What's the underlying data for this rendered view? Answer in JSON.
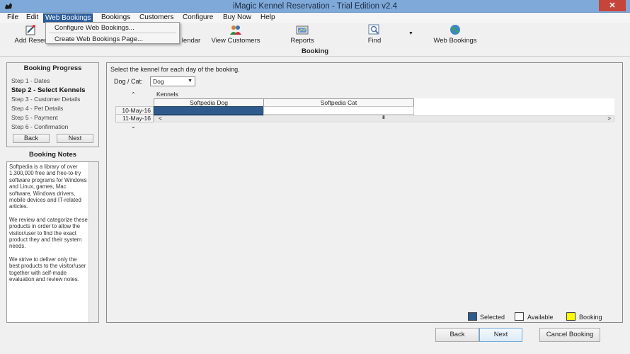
{
  "window": {
    "title": "iMagic Kennel Reservation - Trial Edition v2.4",
    "close_label": "✕"
  },
  "menu": [
    {
      "label": "File"
    },
    {
      "label": "Edit"
    },
    {
      "label": "Web Bookings"
    },
    {
      "label": "Bookings"
    },
    {
      "label": "Customers"
    },
    {
      "label": "Configure"
    },
    {
      "label": "Buy Now"
    },
    {
      "label": "Help"
    }
  ],
  "dropdown": {
    "items": [
      "Configure Web Bookings...",
      "Create Web Bookings Page..."
    ]
  },
  "toolbar": {
    "add_reservation": "Add Reser",
    "calendar": "lendar",
    "view_customers": "View Customers",
    "reports": "Reports",
    "find": "Find",
    "web_bookings": "Web Bookings",
    "more_arrow": "▼"
  },
  "header": {
    "title": "Booking"
  },
  "progress": {
    "title": "Booking Progress",
    "steps": [
      "Step 1 - Dates",
      "Step 2 - Select Kennels",
      "Step 3 - Customer Details",
      "Step 4 - Pet Details",
      "Step 5 - Payment",
      "Step 6 - Confirmation"
    ],
    "current_step": 2,
    "back_label": "Back",
    "next_label": "Next"
  },
  "notes": {
    "title": "Booking Notes",
    "paragraphs": [
      "Softpedia is a library of over 1,300,000 free and free-to-try software programs for Windows and Linux, games, Mac software, Windows drivers, mobile devices and IT-related articles.",
      "We review and categorize these products in order to allow the visitor/user to find the exact product they and their system needs.",
      "We strive to deliver only the best products to the visitor/user together with self-made evaluation and review notes."
    ]
  },
  "main": {
    "instruction": "Select the kennel for each day of the booking.",
    "dog_cat_label": "Dog / Cat:",
    "dog_cat_value": "Dog",
    "kennels_caption": "Kennels",
    "up_arrow": "⌃",
    "down_arrow": "⌄",
    "columns": [
      "Softpedia Dog",
      "Softpedia Cat"
    ],
    "rows": [
      {
        "date": "10-May-16",
        "cells": [
          "selected",
          "available"
        ]
      },
      {
        "date": "11-May-16",
        "cells": [
          "selected",
          "available"
        ]
      }
    ],
    "scroll_left": "<",
    "scroll_right": ">",
    "scroll_thumb": "III"
  },
  "legend": {
    "selected_label": "Selected",
    "selected_color": "#2e5b8c",
    "available_label": "Available",
    "available_color": "#ffffff",
    "booking_label": "Booking",
    "booking_color": "#ffff00"
  },
  "footer": {
    "back_label": "Back",
    "next_label": "Next",
    "cancel_label": "Cancel Booking"
  }
}
